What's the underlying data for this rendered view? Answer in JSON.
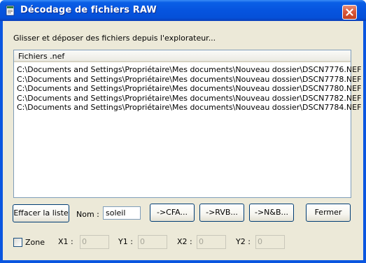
{
  "window": {
    "title": "Décodage de fichiers RAW"
  },
  "hint": "Glisser et déposer des fichiers depuis l'explorateur...",
  "list": {
    "header": "Fichiers .nef",
    "files": [
      "C:\\Documents and Settings\\Propriétaire\\Mes documents\\Nouveau dossier\\DSCN7776.NEF",
      "C:\\Documents and Settings\\Propriétaire\\Mes documents\\Nouveau dossier\\DSCN7778.NEF",
      "C:\\Documents and Settings\\Propriétaire\\Mes documents\\Nouveau dossier\\DSCN7780.NEF",
      "C:\\Documents and Settings\\Propriétaire\\Mes documents\\Nouveau dossier\\DSCN7782.NEF",
      "C:\\Documents and Settings\\Propriétaire\\Mes documents\\Nouveau dossier\\DSCN7784.NEF"
    ]
  },
  "buttons": {
    "clear": "Effacer la liste",
    "cfa": "->CFA...",
    "rvb": "->RVB...",
    "nb": "->N&B...",
    "close": "Fermer"
  },
  "name": {
    "label": "Nom :",
    "value": "soleil"
  },
  "zone": {
    "label": "Zone",
    "checked": false,
    "x1_label": "X1 :",
    "x1": "0",
    "y1_label": "Y1 :",
    "y1": "0",
    "x2_label": "X2 :",
    "x2": "0",
    "y2_label": "Y2 :",
    "y2": "0"
  },
  "icons": {
    "app": "app-window-icon",
    "close": "close-icon"
  }
}
